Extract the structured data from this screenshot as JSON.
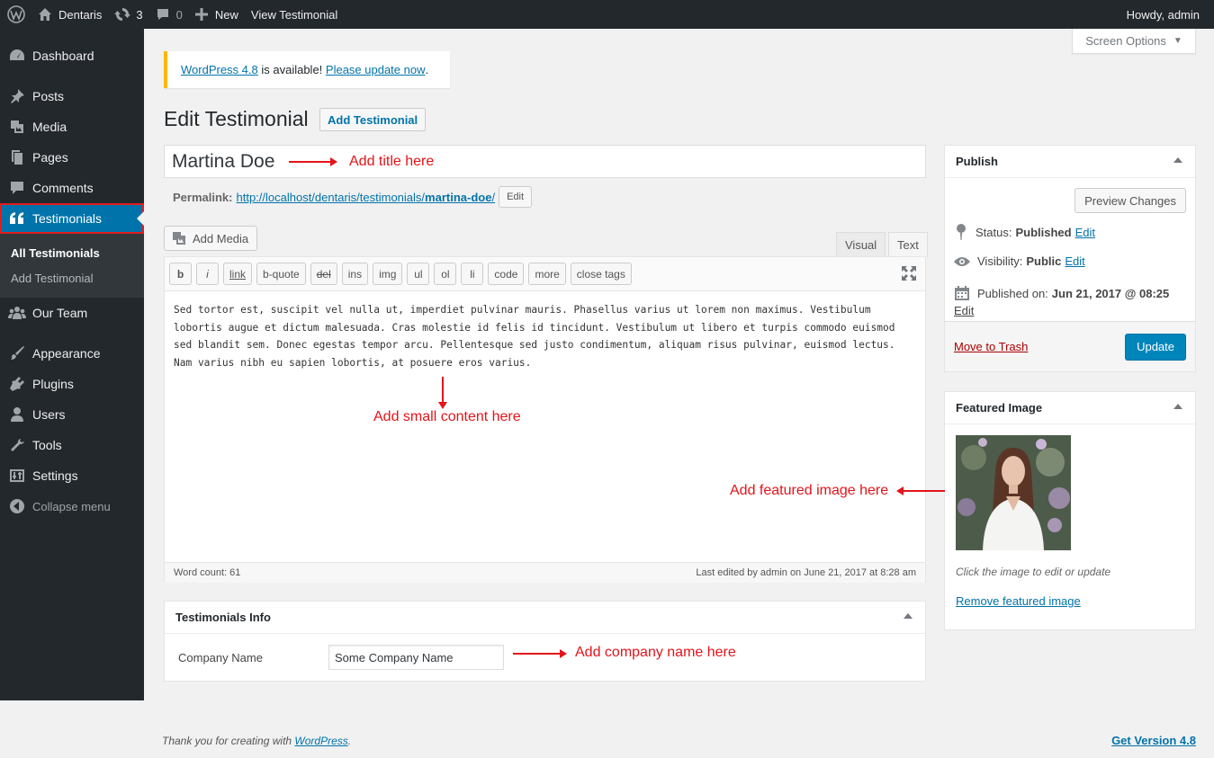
{
  "adminbar": {
    "site_name": "Dentaris",
    "updates_count": "3",
    "comments_count": "0",
    "new_label": "New",
    "view_label": "View Testimonial",
    "howdy": "Howdy, admin"
  },
  "sidebar": {
    "items": [
      {
        "label": "Dashboard",
        "icon": "dashboard-icon"
      },
      {
        "label": "Posts",
        "icon": "pin-icon"
      },
      {
        "label": "Media",
        "icon": "media-icon"
      },
      {
        "label": "Pages",
        "icon": "pages-icon"
      },
      {
        "label": "Comments",
        "icon": "comment-icon"
      },
      {
        "label": "Testimonials",
        "icon": "quote-icon"
      },
      {
        "label": "Our Team",
        "icon": "groups-icon"
      },
      {
        "label": "Appearance",
        "icon": "brush-icon"
      },
      {
        "label": "Plugins",
        "icon": "plugin-icon"
      },
      {
        "label": "Users",
        "icon": "users-icon"
      },
      {
        "label": "Tools",
        "icon": "wrench-icon"
      },
      {
        "label": "Settings",
        "icon": "settings-icon"
      },
      {
        "label": "Collapse menu",
        "icon": "collapse-icon"
      }
    ],
    "submenu": [
      "All Testimonials",
      "Add Testimonial"
    ]
  },
  "screen_options": "Screen Options",
  "notice": {
    "link1": "WordPress 4.8",
    "middle": " is available! ",
    "link2": "Please update now",
    "end": "."
  },
  "page": {
    "title": "Edit Testimonial",
    "add_button": "Add Testimonial"
  },
  "post": {
    "title": "Martina Doe",
    "permalink_label": "Permalink:",
    "permalink_base": "http://localhost/dentaris/testimonials/",
    "permalink_slug": "martina-doe",
    "permalink_end": "/",
    "edit_label": "Edit"
  },
  "editor": {
    "add_media": "Add Media",
    "tab_visual": "Visual",
    "tab_text": "Text",
    "quicktags": [
      "b",
      "i",
      "link",
      "b-quote",
      "del",
      "ins",
      "img",
      "ul",
      "ol",
      "li",
      "code",
      "more",
      "close tags"
    ],
    "content": "Sed tortor est, suscipit vel nulla ut, imperdiet pulvinar mauris. Phasellus varius ut lorem non maximus. Vestibulum lobortis augue et dictum malesuada. Cras molestie id felis id tincidunt. Vestibulum ut libero et turpis commodo euismod sed blandit sem. Donec egestas tempor arcu. Pellentesque sed justo condimentum, aliquam risus pulvinar, euismod lectus. Nam varius nibh eu sapien lobortis, at posuere eros varius.",
    "word_count": "Word count: 61",
    "last_edited": "Last edited by admin on June 21, 2017 at 8:28 am"
  },
  "testimonial_info": {
    "title": "Testimonials Info",
    "company_label": "Company Name",
    "company_value": "Some Company Name"
  },
  "publish": {
    "title": "Publish",
    "preview": "Preview Changes",
    "status_label": "Status:",
    "status_value": "Published",
    "visibility_label": "Visibility:",
    "visibility_value": "Public",
    "published_label": "Published on:",
    "published_value": "Jun 21, 2017 @ 08:25",
    "edit": "Edit",
    "trash": "Move to Trash",
    "update": "Update"
  },
  "featured": {
    "title": "Featured Image",
    "caption": "Click the image to edit or update",
    "remove": "Remove featured image"
  },
  "annotations": {
    "title": "Add title here",
    "content": "Add small content here",
    "featured": "Add featured image here",
    "company": "Add company name here"
  },
  "footer": {
    "thanks_prefix": "Thank you for creating with ",
    "thanks_link": "WordPress",
    "thanks_end": ".",
    "version": "Get Version 4.8"
  },
  "colors": {
    "admin_dark": "#23282d",
    "accent_blue": "#0073aa",
    "annotation_red": "#e3141a",
    "notice_yellow": "#ffb900"
  }
}
